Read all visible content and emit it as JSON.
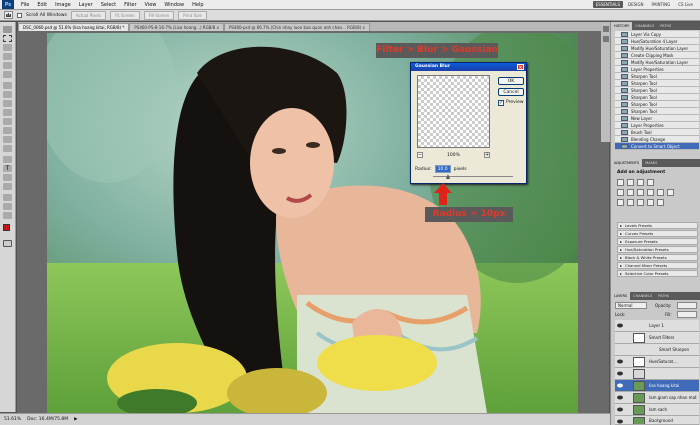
{
  "app": {
    "logo": "Ps"
  },
  "menu": [
    "File",
    "Edit",
    "Image",
    "Layer",
    "Select",
    "Filter",
    "View",
    "Window",
    "Help"
  ],
  "workspace": {
    "items": [
      "ESSENTIALS",
      "DESIGN",
      "PAINTING"
    ],
    "active": "ESSENTIALS",
    "cs_live": "CS Live"
  },
  "options": {
    "scroll_all": "Scroll All Windows",
    "buttons": [
      "Actual Pixels",
      "Fit Screen",
      "Fill Screen",
      "Print Size"
    ]
  },
  "tabs": [
    {
      "label": "DSC_0060.psd @ 51.6% (lisa hoang kitai, RGB/8) *",
      "active": true
    },
    {
      "label": "PS460-PS-8-16-7% (Lisa hoang...) RGB/8 x",
      "active": false
    },
    {
      "label": "PS460-psd @ 66.7% (Chin nhay luon bao quan anh chan...  RGB/8) x",
      "active": false
    }
  ],
  "status": {
    "zoom": "51.61%",
    "doc": "Doc: 16.4M/75.8M"
  },
  "dialog": {
    "title": "Gaussian Blur",
    "ok": "OK",
    "cancel": "Cancel",
    "preview": "Preview",
    "zoom": "100%",
    "radius_label": "Radius:",
    "radius_value": "10.0",
    "radius_unit": "pixels"
  },
  "annotations": {
    "top": "Filter > Blur > Gaussian",
    "bottom": "Radius = 10px"
  },
  "history": {
    "tabs": [
      "HISTORY",
      "CHANNELS",
      "PATHS"
    ],
    "items": [
      "Layer Via Copy",
      "Hue/Saturation 4 Layer",
      "Modify Hue/Saturation Layer",
      "Create Clipping Mask",
      "Modify Hue/Saturation Layer",
      "Layer Properties",
      "Sharpen Tool",
      "Sharpen Tool",
      "Sharpen Tool",
      "Sharpen Tool",
      "Sharpen Tool",
      "Sharpen Tool",
      "New Layer",
      "Layer Properties",
      "Brush Tool",
      "Blending Change",
      "Convert to Smart Object"
    ],
    "selected": 16
  },
  "adjustments": {
    "tabs": [
      "ADJUSTMENTS",
      "MASKS"
    ],
    "title": "Add an adjustment",
    "presets": [
      "Levels Presets",
      "Curves Presets",
      "Exposure Presets",
      "Hue/Saturation Presets",
      "Black & White Presets",
      "Channel Mixer Presets",
      "Selective Color Presets"
    ]
  },
  "layers": {
    "tabs": [
      "LAYERS",
      "CHANNELS",
      "PATHS"
    ],
    "blend": "Normal",
    "opacity_label": "Opacity:",
    "fill_label": "Fill:",
    "lock_label": "Lock:",
    "items": [
      {
        "name": "Layer 1"
      },
      {
        "name": "Smart Filters"
      },
      {
        "name": "Smart Sharpen"
      },
      {
        "name": "Hue/Saturat..."
      },
      {
        "name": ""
      },
      {
        "name": "lisa hoang kitai"
      },
      {
        "name": "lam giam sap nhan mat"
      },
      {
        "name": "lam sach"
      },
      {
        "name": "Background"
      }
    ],
    "selected": 5
  }
}
